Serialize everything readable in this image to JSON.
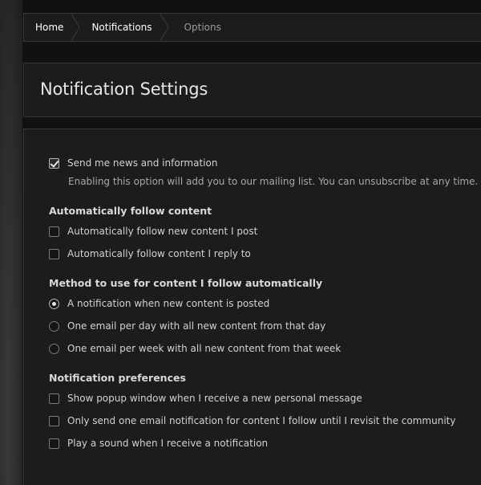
{
  "breadcrumb": {
    "items": [
      {
        "label": "Home"
      },
      {
        "label": "Notifications"
      },
      {
        "label": "Options"
      }
    ]
  },
  "page": {
    "title": "Notification Settings"
  },
  "newsletter": {
    "label": "Send me news and information",
    "checked": true,
    "description": "Enabling this option will add you to our mailing list. You can unsubscribe at any time."
  },
  "auto_follow": {
    "heading": "Automatically follow content",
    "options": [
      {
        "label": "Automatically follow new content I post",
        "checked": false
      },
      {
        "label": "Automatically follow content I reply to",
        "checked": false
      }
    ]
  },
  "follow_method": {
    "heading": "Method to use for content I follow automatically",
    "options": [
      {
        "label": "A notification when new content is posted",
        "selected": true
      },
      {
        "label": "One email per day with all new content from that day",
        "selected": false
      },
      {
        "label": "One email per week with all new content from that week",
        "selected": false
      }
    ]
  },
  "preferences": {
    "heading": "Notification preferences",
    "options": [
      {
        "label": "Show popup window when I receive a new personal message",
        "checked": false
      },
      {
        "label": "Only send one email notification for content I follow until I revisit the community",
        "checked": false
      },
      {
        "label": "Play a sound when I receive a notification",
        "checked": false
      }
    ]
  }
}
